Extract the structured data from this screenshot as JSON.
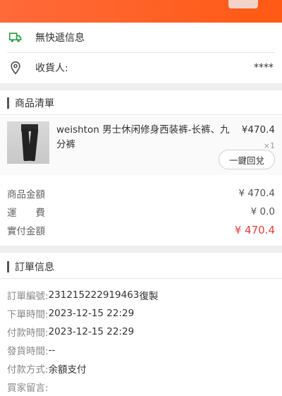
{
  "logistics": {
    "label": "無快遞信息"
  },
  "receiver": {
    "label": "收貨人:",
    "value": "****"
  },
  "product_section": {
    "title": "商品清單"
  },
  "product": {
    "name": "weishton 男士休闲修身西装裤-长裤、九分裤",
    "price": "¥470.4",
    "qty": "×1",
    "button": "一鍵回兌"
  },
  "amounts": [
    {
      "label": "商品金額",
      "value": "¥ 470.4"
    },
    {
      "label": "運　　費",
      "value": "¥ 0.0"
    },
    {
      "label": "實付金額",
      "value": "¥ 470.4"
    }
  ],
  "order_section": {
    "title": "訂單信息"
  },
  "order": {
    "number_label": "訂單編號:",
    "number": "231215222919463",
    "copy": "復製",
    "placed_label": "下單時間:",
    "placed": "2023-12-15 22:29",
    "paid_label": "付款時間:",
    "paid": "2023-12-15 22:29",
    "ship_label": "發貨時間:",
    "ship": "--",
    "method_label": "付款方式:",
    "method": "余額支付",
    "note_label": "買家留言:",
    "note": ""
  },
  "colors": {
    "accent": "#ff5a14",
    "price_red": "#e0403b",
    "section_bg": "#eeeef0"
  },
  "icons": {
    "logistics": "truck-icon",
    "receiver": "location-pin-icon"
  }
}
